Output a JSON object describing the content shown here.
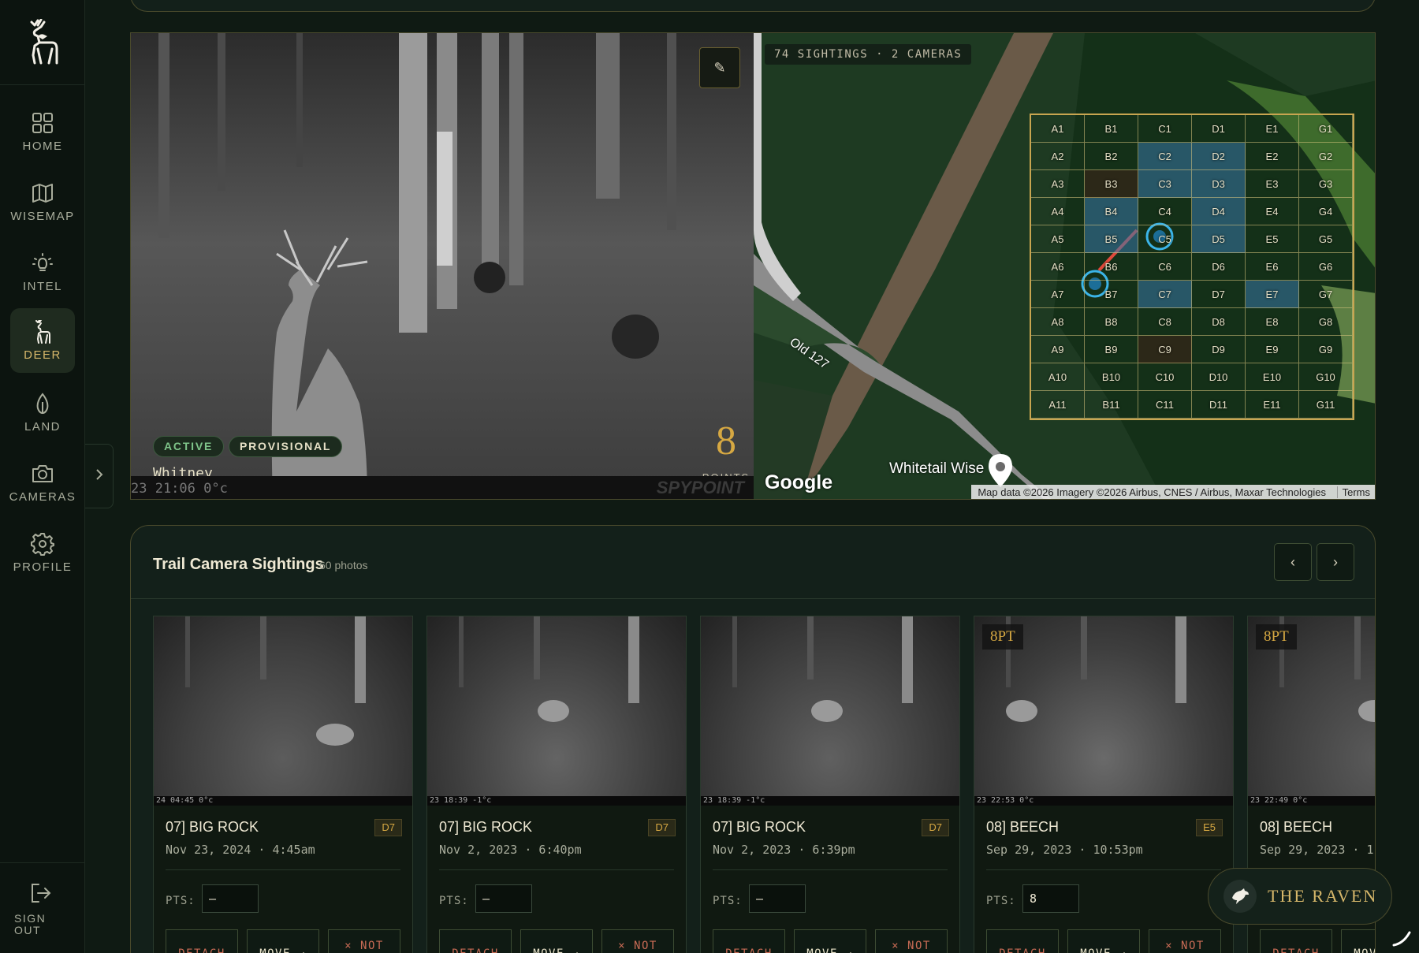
{
  "sidebar": {
    "items": [
      {
        "label": "HOME",
        "icon": "grid-icon"
      },
      {
        "label": "WISEMAP",
        "icon": "map-icon"
      },
      {
        "label": "INTEL",
        "icon": "lightbulb-icon"
      },
      {
        "label": "DEER",
        "icon": "deer-icon"
      },
      {
        "label": "LAND",
        "icon": "leaf-icon"
      },
      {
        "label": "CAMERAS",
        "icon": "camera-icon"
      },
      {
        "label": "PROFILE",
        "icon": "gear-icon"
      }
    ],
    "active": "DEER",
    "sign_out": "SIGN OUT"
  },
  "hero": {
    "status_badge": "ACTIVE",
    "confidence_badge": "PROVISIONAL",
    "name": "Whitney",
    "points_value": "8",
    "points_label": "POINTS",
    "photo_stamp": "23 21:06 0°c",
    "camera_brand": "SPYPOINT"
  },
  "map": {
    "info": "74 SIGHTINGS · 2 CAMERAS",
    "road_label": "Old 127",
    "place_label": "Whitetail Wise",
    "provider": "Google",
    "attribution": "Map data ©2026 Imagery ©2026 Airbus, CNES / Airbus, Maxar Technologies",
    "terms": "Terms",
    "grid": {
      "columns": [
        "A",
        "B",
        "C",
        "D",
        "E",
        "G"
      ],
      "rows": [
        "1",
        "2",
        "3",
        "4",
        "5",
        "6",
        "7",
        "8",
        "9",
        "10",
        "11"
      ],
      "highlighted": [
        "C2",
        "C3",
        "D2",
        "D3",
        "B4",
        "D4",
        "B5",
        "D5",
        "C7",
        "E7"
      ],
      "dark": [
        "B3",
        "C9"
      ]
    }
  },
  "sightings": {
    "title": "Trail Camera Sightings",
    "count": "60 photos",
    "prev": "‹",
    "next": "›",
    "cards": [
      {
        "title": "07] BIG ROCK",
        "grid": "D7",
        "date": "Nov 23, 2024 · 4:45am",
        "pts": "—",
        "tag": "",
        "stamp": "24 04:45 0°c"
      },
      {
        "title": "07] BIG ROCK",
        "grid": "D7",
        "date": "Nov 2, 2023 · 6:40pm",
        "pts": "—",
        "tag": "",
        "stamp": "23 18:39 -1°c"
      },
      {
        "title": "07] BIG ROCK",
        "grid": "D7",
        "date": "Nov 2, 2023 · 6:39pm",
        "pts": "—",
        "tag": "",
        "stamp": "23 18:39 -1°c"
      },
      {
        "title": "08] BEECH",
        "grid": "E5",
        "date": "Sep 29, 2023 · 10:53pm",
        "pts": "8",
        "tag": "8PT",
        "stamp": "23 22:53 0°c"
      },
      {
        "title": "08] BEECH",
        "grid": "",
        "date": "Sep 29, 2023 · 1",
        "pts": "",
        "tag": "8PT",
        "stamp": "23 22:49 0°c"
      }
    ],
    "pts_label": "PTS:",
    "detach": "DETACH",
    "move": "MOVE →",
    "not_buck": "× NOT BUCK"
  },
  "raven": {
    "label": "THE RAVEN"
  }
}
